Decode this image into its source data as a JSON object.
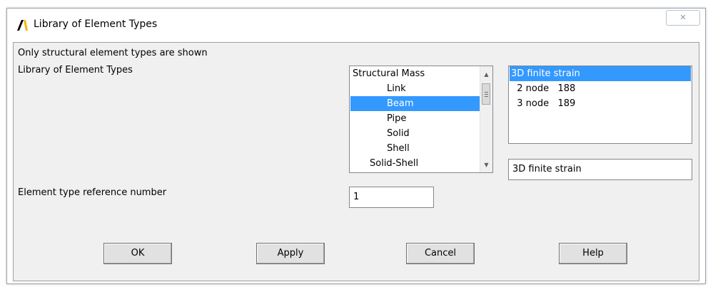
{
  "window": {
    "title": "Library of Element Types",
    "close_glyph": "✕"
  },
  "dialog": {
    "info_text": "Only structural element types are shown",
    "library_label": "Library of Element Types",
    "ref_label": "Element type reference number",
    "ref_value": "1"
  },
  "categories": [
    {
      "label": "Structural Mass",
      "indent": 0
    },
    {
      "label": "Link",
      "indent": 1
    },
    {
      "label": "Beam",
      "indent": 1,
      "selected": true
    },
    {
      "label": "Pipe",
      "indent": 1
    },
    {
      "label": "Solid",
      "indent": 1
    },
    {
      "label": "Shell",
      "indent": 1
    },
    {
      "label": "Solid-Shell",
      "indent": 0.5
    }
  ],
  "types": [
    {
      "label": "3D finite strain",
      "selected": true
    },
    {
      "label": "  2 node   188"
    },
    {
      "label": "  3 node   189"
    }
  ],
  "selected_type_text": "3D finite strain",
  "buttons": {
    "ok": "OK",
    "apply": "Apply",
    "cancel": "Cancel",
    "help": "Help"
  },
  "colors": {
    "selection": "#3399ff",
    "dialog_bg": "#f0f0f0"
  }
}
